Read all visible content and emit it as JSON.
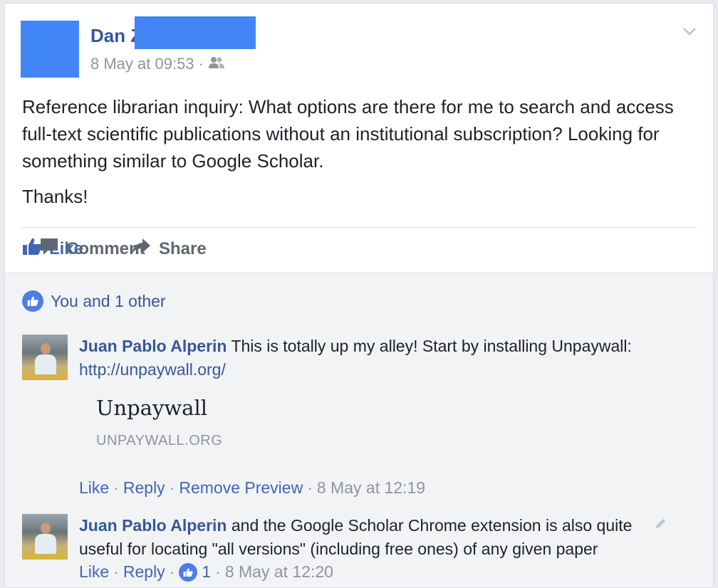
{
  "post": {
    "author": "Dan Z",
    "timestamp": "8 May at 09:53",
    "meta_separator": "·",
    "privacy_icon": "friends-icon",
    "menu_icon": "chevron-down-icon",
    "text_paragraph_1": "Reference librarian inquiry: What options are there for me to search and access full-text scientific publications without an institutional subscription? Looking for something similar to Google Scholar.",
    "text_paragraph_2": "Thanks!"
  },
  "actions": {
    "like_label": "Like",
    "comment_label": "Comment",
    "share_label": "Share"
  },
  "likes_summary": "You and 1 other",
  "comments": [
    {
      "author": "Juan Pablo Alperin",
      "text": "This is totally up my alley! Start by installing Unpaywall:",
      "link": "http://unpaywall.org/",
      "preview": {
        "title": "Unpaywall",
        "domain": "UNPAYWALL.ORG"
      },
      "like_label": "Like",
      "reply_label": "Reply",
      "remove_preview_label": "Remove Preview",
      "timestamp": "8 May at 12:19"
    },
    {
      "author": "Juan Pablo Alperin",
      "text": "and the Google Scholar Chrome extension is also quite useful for locating \"all versions\" (including free ones) of any given paper",
      "like_label": "Like",
      "reply_label": "Reply",
      "like_count": "1",
      "timestamp": "8 May at 12:20"
    }
  ],
  "colors": {
    "link_blue": "#365899",
    "like_blue": "#4267b2",
    "redaction_blue": "#4285f4",
    "muted_gray": "#90949c"
  }
}
